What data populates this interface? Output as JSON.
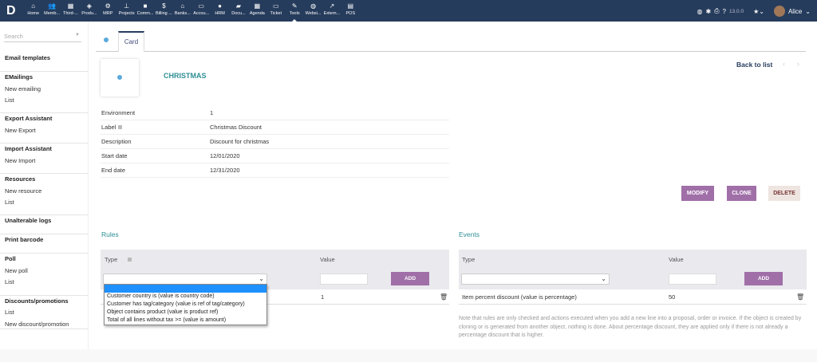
{
  "topbar": {
    "logo": "D",
    "menu": [
      {
        "label": "Home",
        "icon": "⌂"
      },
      {
        "label": "Memb...",
        "icon": "👥"
      },
      {
        "label": "Third-...",
        "icon": "▦"
      },
      {
        "label": "Produ...",
        "icon": "◈"
      },
      {
        "label": "MRP",
        "icon": "⚙"
      },
      {
        "label": "Projects",
        "icon": "⊥"
      },
      {
        "label": "Comm...",
        "icon": "■"
      },
      {
        "label": "Billing ...",
        "icon": "$"
      },
      {
        "label": "Banks...",
        "icon": "⌂"
      },
      {
        "label": "Accou...",
        "icon": "▭"
      },
      {
        "label": "HRM",
        "icon": "●"
      },
      {
        "label": "Docu...",
        "icon": "▰"
      },
      {
        "label": "Agenda",
        "icon": "▦"
      },
      {
        "label": "Ticket",
        "icon": "▭"
      },
      {
        "label": "Tools",
        "icon": "✎"
      },
      {
        "label": "Websi...",
        "icon": "◍"
      },
      {
        "label": "Extern...",
        "icon": "↗"
      },
      {
        "label": "POS",
        "icon": "▤"
      }
    ],
    "version": "13.0.0",
    "user": "Alice"
  },
  "sidebar": {
    "search_placeholder": "Search",
    "items": [
      {
        "label": "Email templates",
        "h": true
      },
      {
        "label": "EMailings",
        "h": true
      },
      {
        "label": "New emailing"
      },
      {
        "label": "List"
      },
      {
        "label": "Export Assistant",
        "h": true
      },
      {
        "label": "New Export"
      },
      {
        "label": "Import Assistant",
        "h": true
      },
      {
        "label": "New Import"
      },
      {
        "label": "Resources",
        "h": true
      },
      {
        "label": "New resource"
      },
      {
        "label": "List"
      },
      {
        "label": "Unalterable logs",
        "h": true
      },
      {
        "label": "Print barcode",
        "h": true
      },
      {
        "label": "Poll",
        "h": true
      },
      {
        "label": "New poll"
      },
      {
        "label": "List"
      },
      {
        "label": "Discounts/promotions",
        "h": true
      },
      {
        "label": "List"
      },
      {
        "label": "New discount/promotion"
      }
    ]
  },
  "tab": "Card",
  "record": {
    "title": "CHRISTMAS",
    "back": "Back to list",
    "prev": "‹",
    "next": "›"
  },
  "fields": [
    {
      "label": "Environment",
      "value": "1"
    },
    {
      "label": "Label",
      "value": "Christmas Discount",
      "help": true
    },
    {
      "label": "Description",
      "value": "Discount for christmas"
    },
    {
      "label": "Start date",
      "value": "12/01/2020"
    },
    {
      "label": "End date",
      "value": "12/31/2020"
    }
  ],
  "actions": {
    "modify": "MODIFY",
    "clone": "CLONE",
    "delete": "DELETE"
  },
  "rules": {
    "title": "Rules",
    "col_type": "Type",
    "col_value": "Value",
    "add": "ADD",
    "row": {
      "type": "",
      "value": "1"
    },
    "options": [
      "",
      "Customer country is (value is country code)",
      "Customer has tag/category (value is ref of tag/category)",
      "Object contains product (value is product ref)",
      "Total of all lines without tax >= (value is amount)"
    ]
  },
  "events": {
    "title": "Events",
    "col_type": "Type",
    "col_value": "Value",
    "add": "ADD",
    "row": {
      "type": "Item percent discount (value is percentage)",
      "value": "50"
    },
    "note": "Note that rules are only checked and actions executed when you add a new line into a proposal, order or invoice. If the object is created by cloning or is generated from another object, nothing is done. About percentage discount, they are applied only if there is not already a percentage discount that is higher."
  }
}
